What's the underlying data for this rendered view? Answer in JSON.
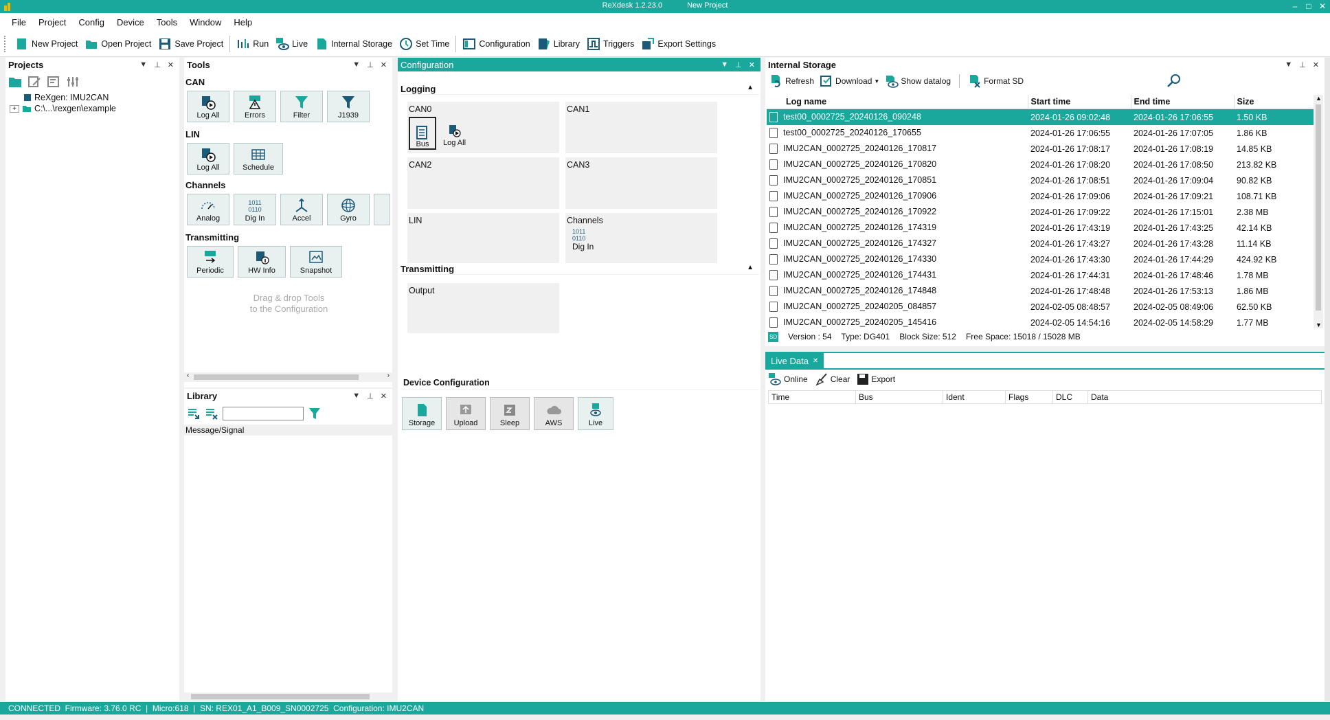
{
  "window": {
    "app_title": "ReXdesk 1.2.23.0",
    "project_title": "New Project",
    "controls": [
      "–",
      "□",
      "✕"
    ]
  },
  "menu": [
    "File",
    "Project",
    "Config",
    "Device",
    "Tools",
    "Window",
    "Help"
  ],
  "toolbar": {
    "new_project": "New Project",
    "open_project": "Open Project",
    "save_project": "Save Project",
    "run": "Run",
    "live": "Live",
    "internal_storage": "Internal Storage",
    "set_time": "Set Time",
    "configuration": "Configuration",
    "library": "Library",
    "triggers": "Triggers",
    "export_settings": "Export Settings"
  },
  "projects": {
    "title": "Projects",
    "tree": [
      "ReXgen: IMU2CAN",
      "C:\\...\\rexgen\\example"
    ],
    "expander": "+"
  },
  "tools": {
    "title": "Tools",
    "can_title": "CAN",
    "can": [
      "Log All",
      "Errors",
      "Filter",
      "J1939"
    ],
    "lin_title": "LIN",
    "lin": [
      "Log All",
      "Schedule"
    ],
    "channels_title": "Channels",
    "channels": [
      "Analog",
      "Dig In",
      "Accel",
      "Gyro"
    ],
    "transmitting_title": "Transmitting",
    "transmitting": [
      "Periodic",
      "HW Info",
      "Snapshot"
    ],
    "hint_line1": "Drag & drop Tools",
    "hint_line2": "to the Configuration",
    "binary_text": [
      "1011",
      "0110"
    ]
  },
  "library": {
    "title": "Library",
    "filter_value": "",
    "column": "Message/Signal"
  },
  "configuration": {
    "title": "Configuration",
    "logging_title": "Logging",
    "can0": "CAN0",
    "can1": "CAN1",
    "can2": "CAN2",
    "can3": "CAN3",
    "lin": "LIN",
    "channels": "Channels",
    "bus": "Bus",
    "log_all": "Log All",
    "dig_in": "Dig In",
    "transmitting_title": "Transmitting",
    "output": "Output",
    "device_config_title": "Device Configuration",
    "device_buttons": [
      "Storage",
      "Upload",
      "Sleep",
      "AWS",
      "Live"
    ],
    "collapse_glyph": "▲"
  },
  "internal_storage": {
    "title": "Internal Storage",
    "toolbar": {
      "refresh": "Refresh",
      "download": "Download",
      "show_datalog": "Show datalog",
      "format_sd": "Format SD"
    },
    "search_value": "",
    "columns": [
      "Log name",
      "Start time",
      "End time",
      "Size"
    ],
    "rows": [
      [
        "test00_0002725_20240126_090248",
        "2024-01-26 09:02:48",
        "2024-01-26 17:06:55",
        "1.50 KB"
      ],
      [
        "test00_0002725_20240126_170655",
        "2024-01-26 17:06:55",
        "2024-01-26 17:07:05",
        "1.86 KB"
      ],
      [
        "IMU2CAN_0002725_20240126_170817",
        "2024-01-26 17:08:17",
        "2024-01-26 17:08:19",
        "14.85 KB"
      ],
      [
        "IMU2CAN_0002725_20240126_170820",
        "2024-01-26 17:08:20",
        "2024-01-26 17:08:50",
        "213.82 KB"
      ],
      [
        "IMU2CAN_0002725_20240126_170851",
        "2024-01-26 17:08:51",
        "2024-01-26 17:09:04",
        "90.82 KB"
      ],
      [
        "IMU2CAN_0002725_20240126_170906",
        "2024-01-26 17:09:06",
        "2024-01-26 17:09:21",
        "108.71 KB"
      ],
      [
        "IMU2CAN_0002725_20240126_170922",
        "2024-01-26 17:09:22",
        "2024-01-26 17:15:01",
        "2.38 MB"
      ],
      [
        "IMU2CAN_0002725_20240126_174319",
        "2024-01-26 17:43:19",
        "2024-01-26 17:43:25",
        "42.14 KB"
      ],
      [
        "IMU2CAN_0002725_20240126_174327",
        "2024-01-26 17:43:27",
        "2024-01-26 17:43:28",
        "11.14 KB"
      ],
      [
        "IMU2CAN_0002725_20240126_174330",
        "2024-01-26 17:43:30",
        "2024-01-26 17:44:29",
        "424.92 KB"
      ],
      [
        "IMU2CAN_0002725_20240126_174431",
        "2024-01-26 17:44:31",
        "2024-01-26 17:48:46",
        "1.78 MB"
      ],
      [
        "IMU2CAN_0002725_20240126_174848",
        "2024-01-26 17:48:48",
        "2024-01-26 17:53:13",
        "1.86 MB"
      ],
      [
        "IMU2CAN_0002725_20240205_084857",
        "2024-02-05 08:48:57",
        "2024-02-05 08:49:06",
        "62.50 KB"
      ],
      [
        "IMU2CAN_0002725_20240205_145416",
        "2024-02-05 14:54:16",
        "2024-02-05 14:58:29",
        "1.77 MB"
      ]
    ],
    "info": {
      "version": "Version : 54",
      "type": "Type: DG401",
      "block_size": "Block Size: 512",
      "free_space": "Free Space: 15018 / 15028 MB"
    },
    "sd_badge": "SD"
  },
  "live_data": {
    "tab": "Live Data",
    "online": "Online",
    "clear": "Clear",
    "export": "Export",
    "columns": [
      "Time",
      "Bus",
      "Ident",
      "Flags",
      "DLC",
      "Data"
    ]
  },
  "status": {
    "text": "CONNECTED  Firmware: 3.76.0 RC  |  Micro:618  |  SN: REX01_A1_B009_SN0002725  Configuration: IMU2CAN"
  },
  "colors": {
    "accent": "#1aa89c",
    "icon_blue": "#1c5a7a"
  }
}
